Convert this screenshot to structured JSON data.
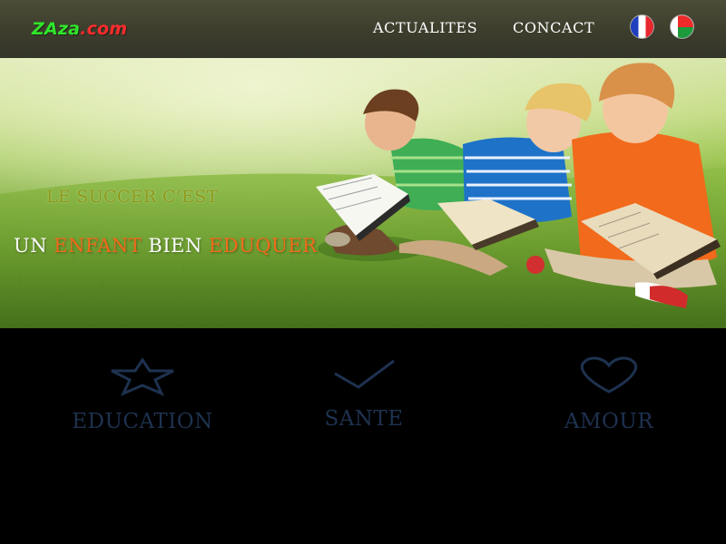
{
  "header": {
    "logo": {
      "part1": "ZA",
      "part2": "za",
      "part3": ".com"
    },
    "nav": [
      {
        "label": "ACTUALITES"
      },
      {
        "label": "CONCACT"
      }
    ]
  },
  "hero": {
    "line1": "LE SUCCER C’EST",
    "line2": {
      "w1": "UN ",
      "w2": "ENFANT",
      "w3": " BIEN ",
      "w4": "EDUQUER"
    }
  },
  "features": [
    {
      "label": "EDUCATION",
      "icon": "star-icon"
    },
    {
      "label": "SANTE",
      "icon": "checkmark-icon"
    },
    {
      "label": "AMOUR",
      "icon": "heart-icon"
    }
  ],
  "colors": {
    "accent_orange": "#f26a1b",
    "hero_olive": "#8e9a1a",
    "feature_text": "#1e3250",
    "logo_green": "#2fe62a",
    "logo_red": "#ff2c2c"
  }
}
